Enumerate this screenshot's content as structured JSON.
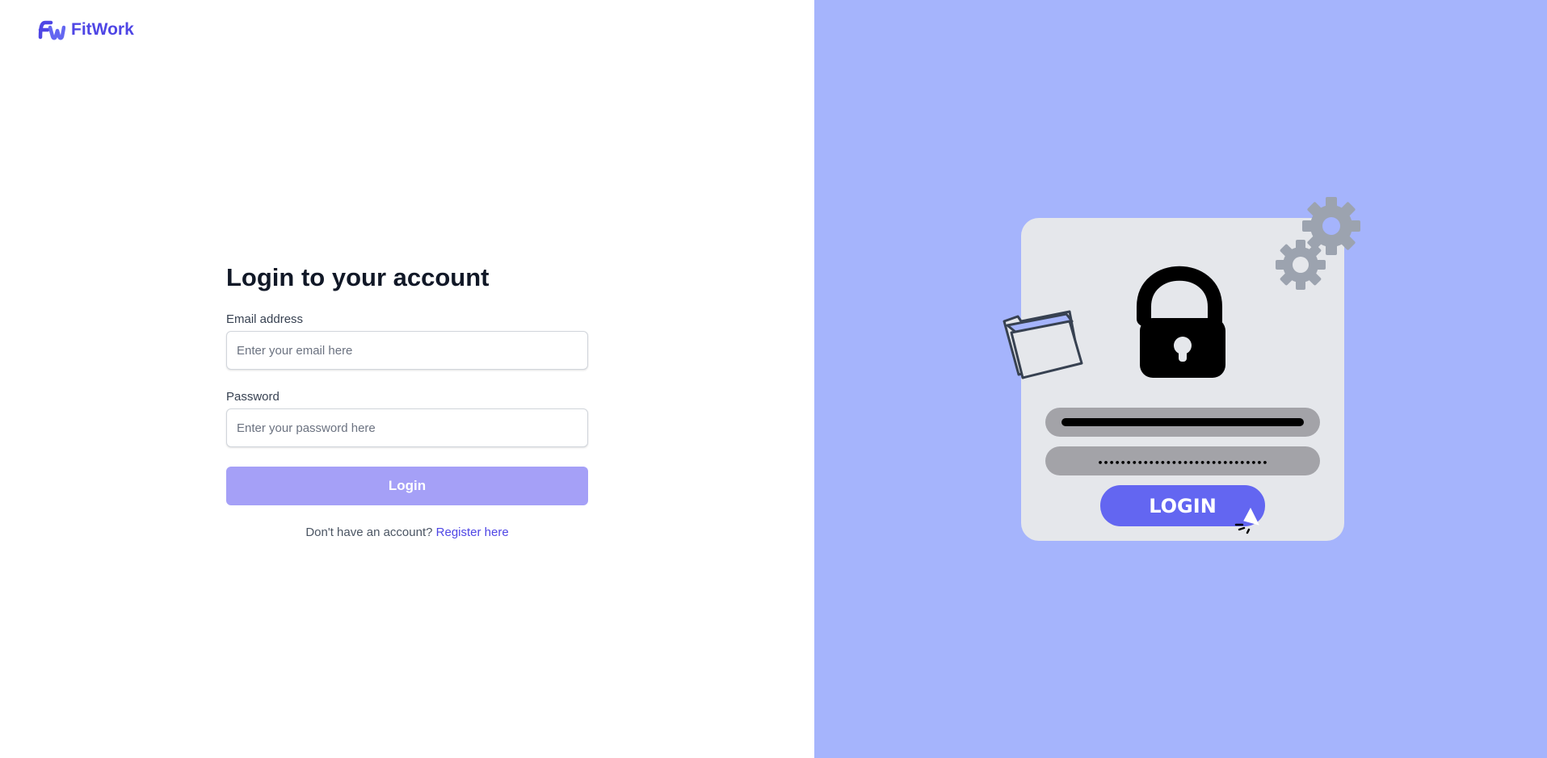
{
  "brand": {
    "name": "FitWork",
    "logo_icon": "fw-logo-icon",
    "color": "#4f46e5"
  },
  "form": {
    "title": "Login to your account",
    "email": {
      "label": "Email address",
      "placeholder": "Enter your email here",
      "value": ""
    },
    "password": {
      "label": "Password",
      "placeholder": "Enter your password here",
      "value": ""
    },
    "submit_label": "Login",
    "register_prompt": "Don't have an account?",
    "register_link": "Register here"
  },
  "illustration": {
    "button_text": "LOGIN",
    "password_dots": "••••••••••••••••••••••••••••••",
    "icons": [
      "unlock-icon",
      "gears-icon",
      "folder-icon",
      "cursor-icon"
    ]
  },
  "colors": {
    "panel_bg": "#a5b4fc",
    "accent": "#4f46e5",
    "login_button": "#a5a0f7",
    "illustration_button": "#6366f1"
  }
}
